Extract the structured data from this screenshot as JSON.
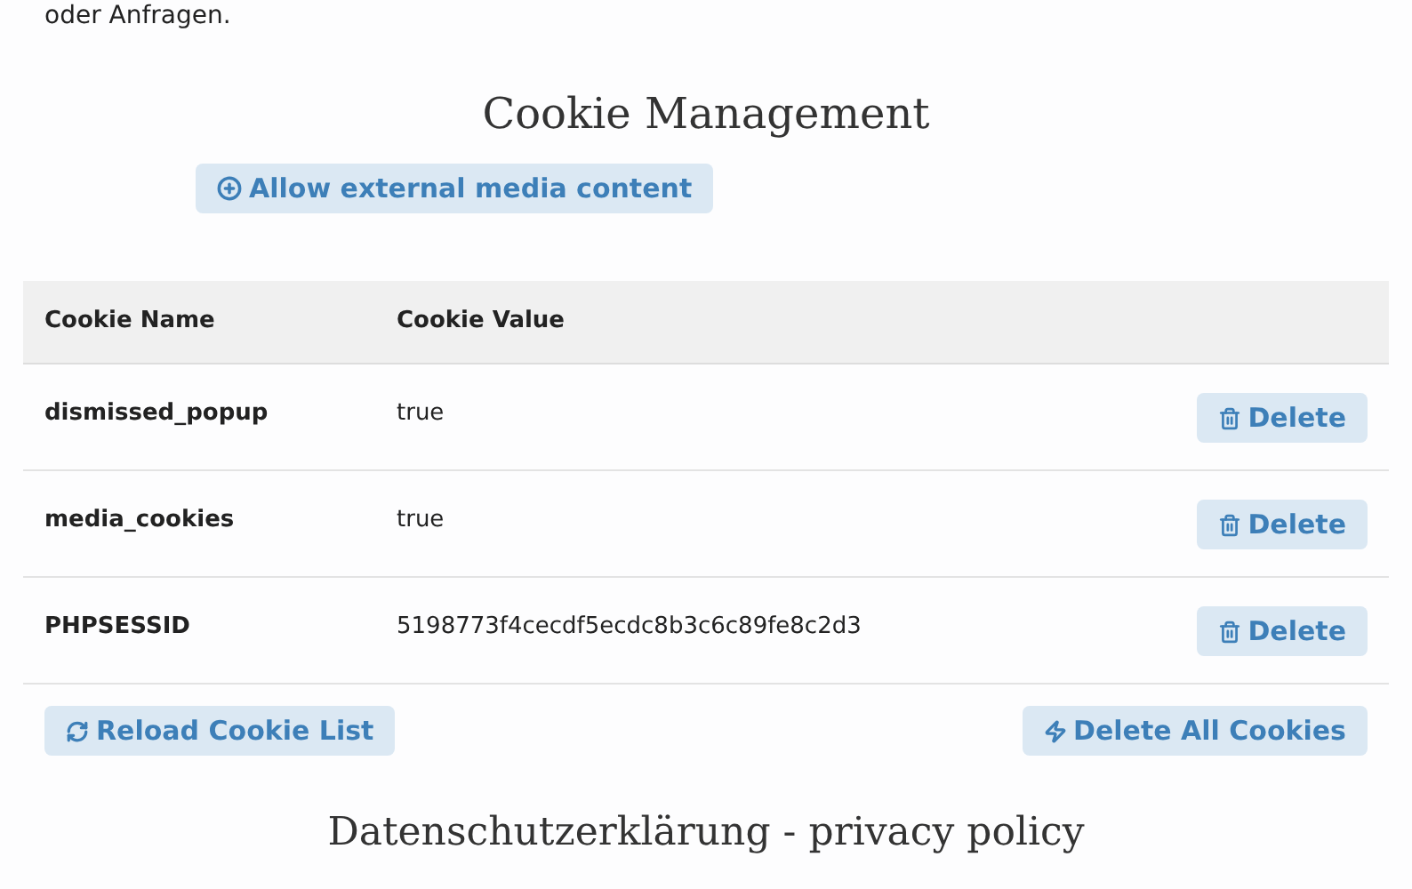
{
  "intro_text": "oder Anfragen.",
  "heading": "Cookie Management",
  "allow_button": {
    "label": "Allow external media content"
  },
  "table": {
    "columns": [
      "Cookie Name",
      "Cookie Value"
    ],
    "rows": [
      {
        "name": "dismissed_popup",
        "value": "true",
        "action": "Delete"
      },
      {
        "name": "media_cookies",
        "value": "true",
        "action": "Delete"
      },
      {
        "name": "PHPSESSID",
        "value": "5198773f4cecdf5ecdc8b3c6c89fe8c2d3",
        "action": "Delete"
      }
    ]
  },
  "reload_button": {
    "label": "Reload Cookie List"
  },
  "delete_all_button": {
    "label": "Delete All Cookies"
  },
  "next_heading": "Datenschutzerklärung - privacy policy"
}
